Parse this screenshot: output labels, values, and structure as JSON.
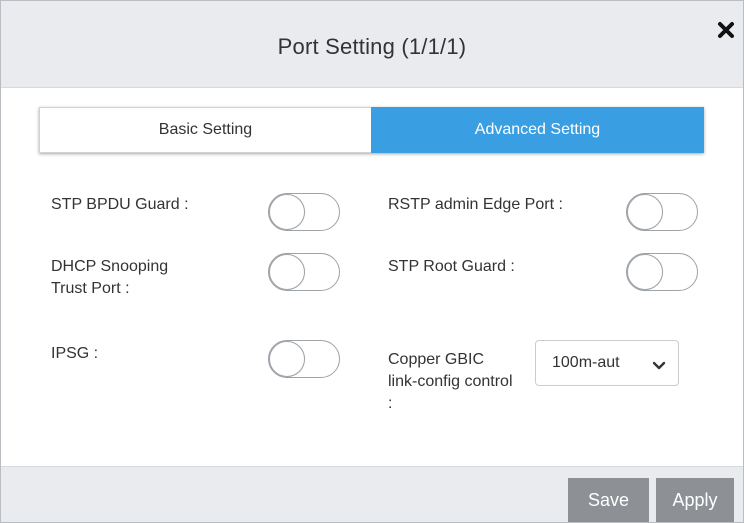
{
  "dialog": {
    "title": "Port Setting (1/1/1)",
    "close_icon": "close-icon"
  },
  "tabs": [
    {
      "label": "Basic Setting",
      "active": false
    },
    {
      "label": "Advanced Setting",
      "active": true
    }
  ],
  "settings": {
    "stp_bpdu_guard": {
      "label": "STP BPDU Guard :",
      "enabled": false
    },
    "rstp_admin_edge_port": {
      "label": "RSTP admin Edge Port :",
      "enabled": false
    },
    "dhcp_snooping_line1": "DHCP Snooping",
    "dhcp_snooping_line2": "Trust Port :",
    "dhcp_snooping_enabled": false,
    "stp_root_guard": {
      "label": "STP Root Guard :",
      "enabled": false
    },
    "ipsg": {
      "label": "IPSG :",
      "enabled": false
    },
    "copper_gbic_line1": "Copper GBIC",
    "copper_gbic_line2": "link-config control",
    "copper_gbic_line3": ":",
    "copper_gbic_value": "100m-aut"
  },
  "footer": {
    "save_label": "Save",
    "apply_label": "Apply"
  },
  "colors": {
    "accent": "#3a9ee2",
    "button": "#8d9195",
    "header_bg": "#e9ebee"
  }
}
